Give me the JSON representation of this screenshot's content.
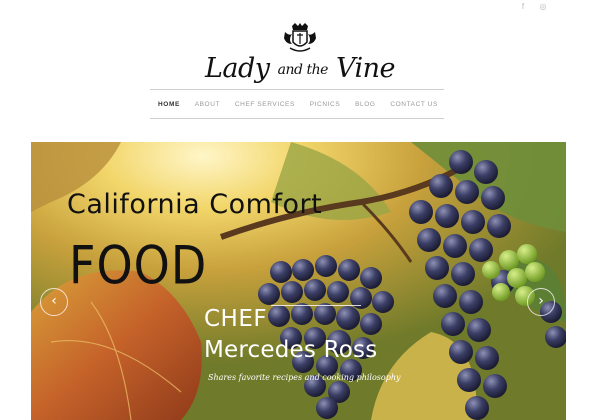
{
  "social": [
    {
      "name": "facebook-icon",
      "glyph": "f"
    },
    {
      "name": "instagram-icon",
      "glyph": "◎"
    }
  ],
  "brand": {
    "part1": "Lady",
    "part2": "and the",
    "part3": "Vine"
  },
  "nav": {
    "items": [
      {
        "label": "HOME",
        "active": true
      },
      {
        "label": "ABOUT"
      },
      {
        "label": "CHEF SERVICES"
      },
      {
        "label": "PICNICS"
      },
      {
        "label": "BLOG"
      },
      {
        "label": "CONTACT US"
      }
    ]
  },
  "hero": {
    "headline1": "California Comfort",
    "headline2": "FOOD",
    "chef_title": "CHEF",
    "chef_name": "Mercedes Ross",
    "tagline": "Shares favorite recipes and cooking philosophy",
    "prev": "‹",
    "next": "›"
  }
}
